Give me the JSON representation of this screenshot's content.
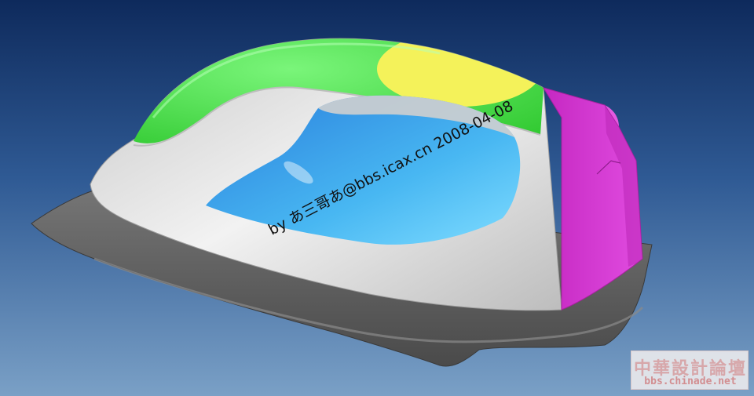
{
  "scene": {
    "subject": "3D surface model of a clothes iron",
    "background_top": "#0e2a5c",
    "background_bottom": "#7aa0c6",
    "colors": {
      "soleplate": "#5d5d5d",
      "body": "#dcdcdc",
      "handle_green": "#3fe03f",
      "handle_yellow": "#f4f25a",
      "heel_magenta": "#d63ad3",
      "cavity_blue": "#3a9bf0"
    }
  },
  "watermark": {
    "text": "by あ三哥あ@bbs.icax.cn 2008-04-08"
  },
  "stamp": {
    "chinese": "中華設計論壇",
    "url": "bbs.chinade.net"
  }
}
